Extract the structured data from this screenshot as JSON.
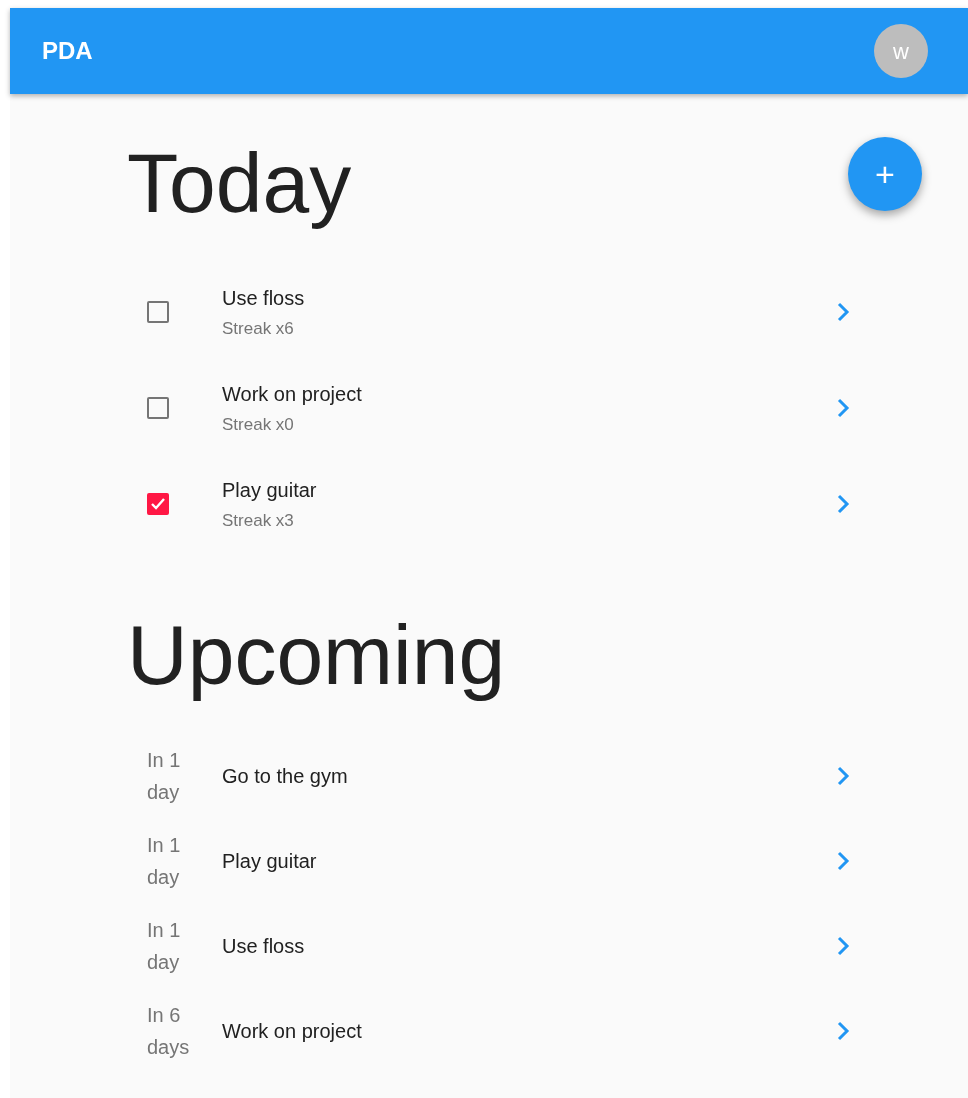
{
  "app_bar": {
    "title": "PDA",
    "avatar": "w"
  },
  "fab": {
    "label": "+"
  },
  "sections": [
    {
      "title": "Today",
      "kind": "habits",
      "items": [
        {
          "name": "Use floss",
          "streak": "Streak x6",
          "checked": false
        },
        {
          "name": "Work on project",
          "streak": "Streak x0",
          "checked": false
        },
        {
          "name": "Play guitar",
          "streak": "Streak x3",
          "checked": true
        }
      ]
    },
    {
      "title": "Upcoming",
      "kind": "upcoming",
      "items": [
        {
          "when": "In 1 day",
          "name": "Go to the gym"
        },
        {
          "when": "In 1 day",
          "name": "Play guitar"
        },
        {
          "when": "In 1 day",
          "name": "Use floss"
        },
        {
          "when": "In 6 days",
          "name": "Work on project"
        }
      ]
    }
  ]
}
